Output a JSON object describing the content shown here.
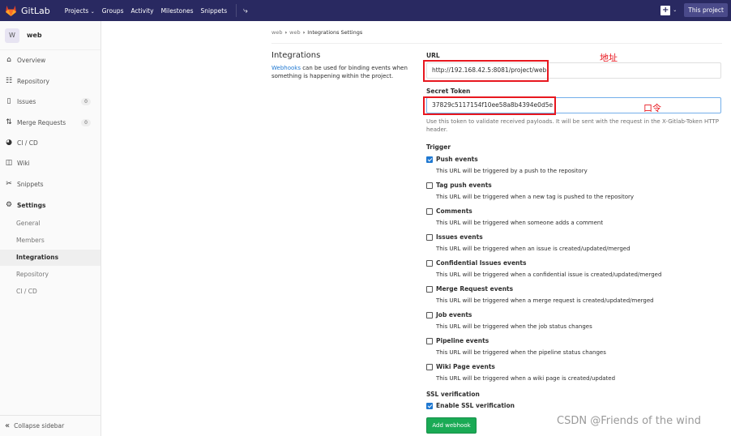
{
  "navbar": {
    "brand": "GitLab",
    "links": [
      "Projects",
      "Groups",
      "Activity",
      "Milestones",
      "Snippets"
    ],
    "this_project": "This project"
  },
  "sidebar": {
    "avatar_letter": "W",
    "project_name": "web",
    "items": [
      {
        "label": "Overview",
        "icon": "home-icon"
      },
      {
        "label": "Repository",
        "icon": "book-icon"
      },
      {
        "label": "Issues",
        "icon": "issues-icon",
        "count": "0"
      },
      {
        "label": "Merge Requests",
        "icon": "merge-request-icon",
        "count": "0"
      },
      {
        "label": "CI / CD",
        "icon": "rocket-icon"
      },
      {
        "label": "Wiki",
        "icon": "book-open-icon"
      },
      {
        "label": "Snippets",
        "icon": "scissors-icon"
      },
      {
        "label": "Settings",
        "icon": "gear-icon"
      }
    ],
    "settings_sub": [
      "General",
      "Members",
      "Integrations",
      "Repository",
      "CI / CD"
    ],
    "collapse": "Collapse sidebar"
  },
  "breadcrumb": [
    "web",
    "web",
    "Integrations Settings"
  ],
  "intro": {
    "title": "Integrations",
    "link": "Webhooks",
    "text": " can be used for binding events when something is happening within the project."
  },
  "form": {
    "url_label": "URL",
    "url_value": "http://192.168.42.5:8081/project/web",
    "token_label": "Secret Token",
    "token_value": "37829c5117154f10ee58a8b4394e0d5e",
    "token_help": "Use this token to validate received payloads. It will be sent with the request in the X-Gitlab-Token HTTP header.",
    "trigger_label": "Trigger",
    "triggers": [
      {
        "label": "Push events",
        "desc": "This URL will be triggered by a push to the repository",
        "checked": true
      },
      {
        "label": "Tag push events",
        "desc": "This URL will be triggered when a new tag is pushed to the repository",
        "checked": false
      },
      {
        "label": "Comments",
        "desc": "This URL will be triggered when someone adds a comment",
        "checked": false
      },
      {
        "label": "Issues events",
        "desc": "This URL will be triggered when an issue is created/updated/merged",
        "checked": false
      },
      {
        "label": "Confidential Issues events",
        "desc": "This URL will be triggered when a confidential issue is created/updated/merged",
        "checked": false
      },
      {
        "label": "Merge Request events",
        "desc": "This URL will be triggered when a merge request is created/updated/merged",
        "checked": false
      },
      {
        "label": "Job events",
        "desc": "This URL will be triggered when the job status changes",
        "checked": false
      },
      {
        "label": "Pipeline events",
        "desc": "This URL will be triggered when the pipeline status changes",
        "checked": false
      },
      {
        "label": "Wiki Page events",
        "desc": "This URL will be triggered when a wiki page is created/updated",
        "checked": false
      }
    ],
    "ssl_label": "SSL verification",
    "ssl_checkbox": "Enable SSL verification",
    "ssl_checked": true,
    "submit": "Add webhook"
  },
  "annotations": {
    "url_note": "地址",
    "token_note": "口令",
    "color": "#e8171f"
  },
  "watermark": "CSDN @Friends of the wind"
}
